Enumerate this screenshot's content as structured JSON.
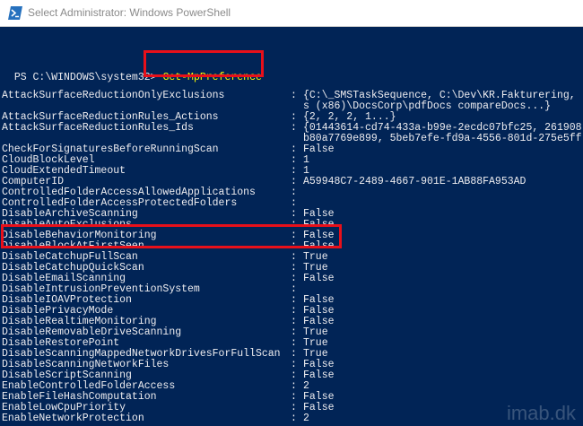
{
  "window": {
    "title": "Select Administrator: Windows PowerShell",
    "icon": "powershell-icon"
  },
  "console": {
    "prompt": "PS C:\\WINDOWS\\system32> ",
    "command": "Get-MpPreference",
    "rows": [
      {
        "name": "AttackSurfaceReductionOnlyExclusions",
        "sep": ":",
        "value": "{C:\\_SMSTaskSequence, C:\\Dev\\KR.Fakturering,"
      },
      {
        "name": "",
        "sep": "",
        "value": "s (x86)\\DocsCorp\\pdfDocs compareDocs...}"
      },
      {
        "name": "AttackSurfaceReductionRules_Actions",
        "sep": ":",
        "value": "{2, 2, 2, 1...}"
      },
      {
        "name": "AttackSurfaceReductionRules_Ids",
        "sep": ":",
        "value": "{01443614-cd74-433a-b99e-2ecdc07bfc25, 261908"
      },
      {
        "name": "",
        "sep": "",
        "value": "b80a7769e899, 5beb7efe-fd9a-4556-801d-275e5ff"
      },
      {
        "name": "CheckForSignaturesBeforeRunningScan",
        "sep": ":",
        "value": "False"
      },
      {
        "name": "CloudBlockLevel",
        "sep": ":",
        "value": "1"
      },
      {
        "name": "CloudExtendedTimeout",
        "sep": ":",
        "value": "1"
      },
      {
        "name": "ComputerID",
        "sep": ":",
        "value": "A59948C7-2489-4667-901E-1AB88FA953AD"
      },
      {
        "name": "ControlledFolderAccessAllowedApplications",
        "sep": ":",
        "value": ""
      },
      {
        "name": "ControlledFolderAccessProtectedFolders",
        "sep": ":",
        "value": ""
      },
      {
        "name": "DisableArchiveScanning",
        "sep": ":",
        "value": "False"
      },
      {
        "name": "DisableAutoExclusions",
        "sep": ":",
        "value": "False"
      },
      {
        "name": "DisableBehaviorMonitoring",
        "sep": ":",
        "value": "False"
      },
      {
        "name": "DisableBlockAtFirstSeen",
        "sep": ":",
        "value": "False"
      },
      {
        "name": "DisableCatchupFullScan",
        "sep": ":",
        "value": "True"
      },
      {
        "name": "DisableCatchupQuickScan",
        "sep": ":",
        "value": "True"
      },
      {
        "name": "DisableEmailScanning",
        "sep": ":",
        "value": "False"
      },
      {
        "name": "DisableIntrusionPreventionSystem",
        "sep": ":",
        "value": ""
      },
      {
        "name": "DisableIOAVProtection",
        "sep": ":",
        "value": "False"
      },
      {
        "name": "DisablePrivacyMode",
        "sep": ":",
        "value": "False"
      },
      {
        "name": "DisableRealtimeMonitoring",
        "sep": ":",
        "value": "False"
      },
      {
        "name": "DisableRemovableDriveScanning",
        "sep": ":",
        "value": "True"
      },
      {
        "name": "DisableRestorePoint",
        "sep": ":",
        "value": "True"
      },
      {
        "name": "DisableScanningMappedNetworkDrivesForFullScan",
        "sep": ":",
        "value": "True"
      },
      {
        "name": "DisableScanningNetworkFiles",
        "sep": ":",
        "value": "False"
      },
      {
        "name": "DisableScriptScanning",
        "sep": ":",
        "value": "False"
      },
      {
        "name": "EnableControlledFolderAccess",
        "sep": ":",
        "value": "2"
      },
      {
        "name": "EnableFileHashComputation",
        "sep": ":",
        "value": "False"
      },
      {
        "name": "EnableLowCpuPriority",
        "sep": ":",
        "value": "False"
      },
      {
        "name": "EnableNetworkProtection",
        "sep": ":",
        "value": "2"
      }
    ]
  },
  "highlight_color": "#e8101a",
  "command_color": "#ffff00",
  "background_color": "#012456",
  "watermark": "imab.dk"
}
